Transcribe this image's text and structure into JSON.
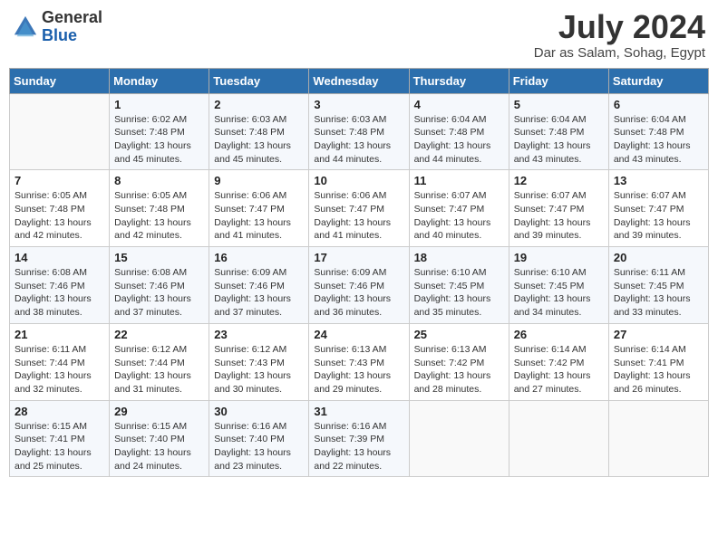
{
  "header": {
    "logo_general": "General",
    "logo_blue": "Blue",
    "month_year": "July 2024",
    "location": "Dar as Salam, Sohag, Egypt"
  },
  "days_of_week": [
    "Sunday",
    "Monday",
    "Tuesday",
    "Wednesday",
    "Thursday",
    "Friday",
    "Saturday"
  ],
  "weeks": [
    [
      {
        "day": "",
        "info": ""
      },
      {
        "day": "1",
        "info": "Sunrise: 6:02 AM\nSunset: 7:48 PM\nDaylight: 13 hours\nand 45 minutes."
      },
      {
        "day": "2",
        "info": "Sunrise: 6:03 AM\nSunset: 7:48 PM\nDaylight: 13 hours\nand 45 minutes."
      },
      {
        "day": "3",
        "info": "Sunrise: 6:03 AM\nSunset: 7:48 PM\nDaylight: 13 hours\nand 44 minutes."
      },
      {
        "day": "4",
        "info": "Sunrise: 6:04 AM\nSunset: 7:48 PM\nDaylight: 13 hours\nand 44 minutes."
      },
      {
        "day": "5",
        "info": "Sunrise: 6:04 AM\nSunset: 7:48 PM\nDaylight: 13 hours\nand 43 minutes."
      },
      {
        "day": "6",
        "info": "Sunrise: 6:04 AM\nSunset: 7:48 PM\nDaylight: 13 hours\nand 43 minutes."
      }
    ],
    [
      {
        "day": "7",
        "info": "Sunrise: 6:05 AM\nSunset: 7:48 PM\nDaylight: 13 hours\nand 42 minutes."
      },
      {
        "day": "8",
        "info": "Sunrise: 6:05 AM\nSunset: 7:48 PM\nDaylight: 13 hours\nand 42 minutes."
      },
      {
        "day": "9",
        "info": "Sunrise: 6:06 AM\nSunset: 7:47 PM\nDaylight: 13 hours\nand 41 minutes."
      },
      {
        "day": "10",
        "info": "Sunrise: 6:06 AM\nSunset: 7:47 PM\nDaylight: 13 hours\nand 41 minutes."
      },
      {
        "day": "11",
        "info": "Sunrise: 6:07 AM\nSunset: 7:47 PM\nDaylight: 13 hours\nand 40 minutes."
      },
      {
        "day": "12",
        "info": "Sunrise: 6:07 AM\nSunset: 7:47 PM\nDaylight: 13 hours\nand 39 minutes."
      },
      {
        "day": "13",
        "info": "Sunrise: 6:07 AM\nSunset: 7:47 PM\nDaylight: 13 hours\nand 39 minutes."
      }
    ],
    [
      {
        "day": "14",
        "info": "Sunrise: 6:08 AM\nSunset: 7:46 PM\nDaylight: 13 hours\nand 38 minutes."
      },
      {
        "day": "15",
        "info": "Sunrise: 6:08 AM\nSunset: 7:46 PM\nDaylight: 13 hours\nand 37 minutes."
      },
      {
        "day": "16",
        "info": "Sunrise: 6:09 AM\nSunset: 7:46 PM\nDaylight: 13 hours\nand 37 minutes."
      },
      {
        "day": "17",
        "info": "Sunrise: 6:09 AM\nSunset: 7:46 PM\nDaylight: 13 hours\nand 36 minutes."
      },
      {
        "day": "18",
        "info": "Sunrise: 6:10 AM\nSunset: 7:45 PM\nDaylight: 13 hours\nand 35 minutes."
      },
      {
        "day": "19",
        "info": "Sunrise: 6:10 AM\nSunset: 7:45 PM\nDaylight: 13 hours\nand 34 minutes."
      },
      {
        "day": "20",
        "info": "Sunrise: 6:11 AM\nSunset: 7:45 PM\nDaylight: 13 hours\nand 33 minutes."
      }
    ],
    [
      {
        "day": "21",
        "info": "Sunrise: 6:11 AM\nSunset: 7:44 PM\nDaylight: 13 hours\nand 32 minutes."
      },
      {
        "day": "22",
        "info": "Sunrise: 6:12 AM\nSunset: 7:44 PM\nDaylight: 13 hours\nand 31 minutes."
      },
      {
        "day": "23",
        "info": "Sunrise: 6:12 AM\nSunset: 7:43 PM\nDaylight: 13 hours\nand 30 minutes."
      },
      {
        "day": "24",
        "info": "Sunrise: 6:13 AM\nSunset: 7:43 PM\nDaylight: 13 hours\nand 29 minutes."
      },
      {
        "day": "25",
        "info": "Sunrise: 6:13 AM\nSunset: 7:42 PM\nDaylight: 13 hours\nand 28 minutes."
      },
      {
        "day": "26",
        "info": "Sunrise: 6:14 AM\nSunset: 7:42 PM\nDaylight: 13 hours\nand 27 minutes."
      },
      {
        "day": "27",
        "info": "Sunrise: 6:14 AM\nSunset: 7:41 PM\nDaylight: 13 hours\nand 26 minutes."
      }
    ],
    [
      {
        "day": "28",
        "info": "Sunrise: 6:15 AM\nSunset: 7:41 PM\nDaylight: 13 hours\nand 25 minutes."
      },
      {
        "day": "29",
        "info": "Sunrise: 6:15 AM\nSunset: 7:40 PM\nDaylight: 13 hours\nand 24 minutes."
      },
      {
        "day": "30",
        "info": "Sunrise: 6:16 AM\nSunset: 7:40 PM\nDaylight: 13 hours\nand 23 minutes."
      },
      {
        "day": "31",
        "info": "Sunrise: 6:16 AM\nSunset: 7:39 PM\nDaylight: 13 hours\nand 22 minutes."
      },
      {
        "day": "",
        "info": ""
      },
      {
        "day": "",
        "info": ""
      },
      {
        "day": "",
        "info": ""
      }
    ]
  ]
}
